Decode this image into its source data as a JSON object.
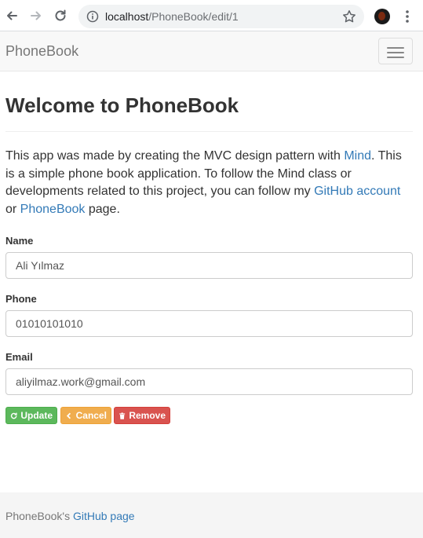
{
  "browser": {
    "url_host": "localhost",
    "url_path": "/PhoneBook/edit/1"
  },
  "navbar": {
    "brand": "PhoneBook"
  },
  "main": {
    "title": "Welcome to PhoneBook",
    "intro": {
      "part1": "This app was made by creating the MVC design pattern with ",
      "link_mind": "Mind",
      "part2": ". This is a simple phone book application. To follow the Mind class or developments related to this project, you can follow my ",
      "link_github": "GitHub account",
      "part3": " or ",
      "link_phonebook": "PhoneBook",
      "part4": " page."
    }
  },
  "form": {
    "name_label": "Name",
    "name_value": "Ali Yılmaz",
    "phone_label": "Phone",
    "phone_value": "01010101010",
    "email_label": "Email",
    "email_value": "aliyilmaz.work@gmail.com"
  },
  "buttons": {
    "update": "Update",
    "cancel": "Cancel",
    "remove": "Remove"
  },
  "footer": {
    "prefix": "PhoneBook's ",
    "link": "GitHub page"
  },
  "colors": {
    "update": "#5cb85c",
    "cancel": "#f0ad4e",
    "remove": "#d9534f",
    "link": "#337ab7"
  }
}
